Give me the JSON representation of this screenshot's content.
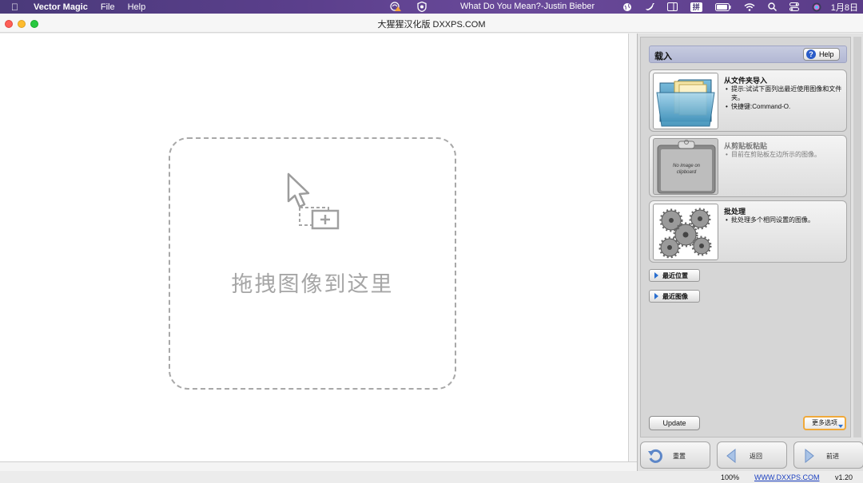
{
  "menubar": {
    "app_name": "Vector Magic",
    "menus": [
      "File",
      "Help"
    ],
    "now_playing": "What Do You Mean?-Justin Bieber",
    "ime_label": "拼",
    "date": "1月8日"
  },
  "window": {
    "title": "大猩猩汉化版 DXXPS.COM"
  },
  "canvas": {
    "drop_text": "拖拽图像到这里"
  },
  "panel": {
    "section_title": "载入",
    "help_label": "Help",
    "cards": [
      {
        "title": "从文件夹导入",
        "bullets": [
          "提示:试试下面列出最近使用图像和文件夹。",
          "快捷键:Command-O."
        ]
      },
      {
        "title": "从剪贴板粘贴",
        "bullets": [
          "目前在剪贴板左边所示的图像。"
        ],
        "thumb_text": "No image on clipboard"
      },
      {
        "title": "批处理",
        "bullets": [
          "批处理多个相同设置的图像。"
        ]
      }
    ],
    "recent_locations": "最近位置",
    "recent_images": "最近图像",
    "update_label": "Update",
    "more_options": "更多选项"
  },
  "nav": {
    "reset": "重置",
    "back": "返回",
    "forward": "前进"
  },
  "status": {
    "zoom": "100%",
    "url": "WWW.DXXPS.COM",
    "version": "v1.20"
  },
  "colors": {
    "menubar": "#5b3f8c",
    "accent_blue": "#2a6fd0",
    "more_border": "#f0a93a"
  }
}
